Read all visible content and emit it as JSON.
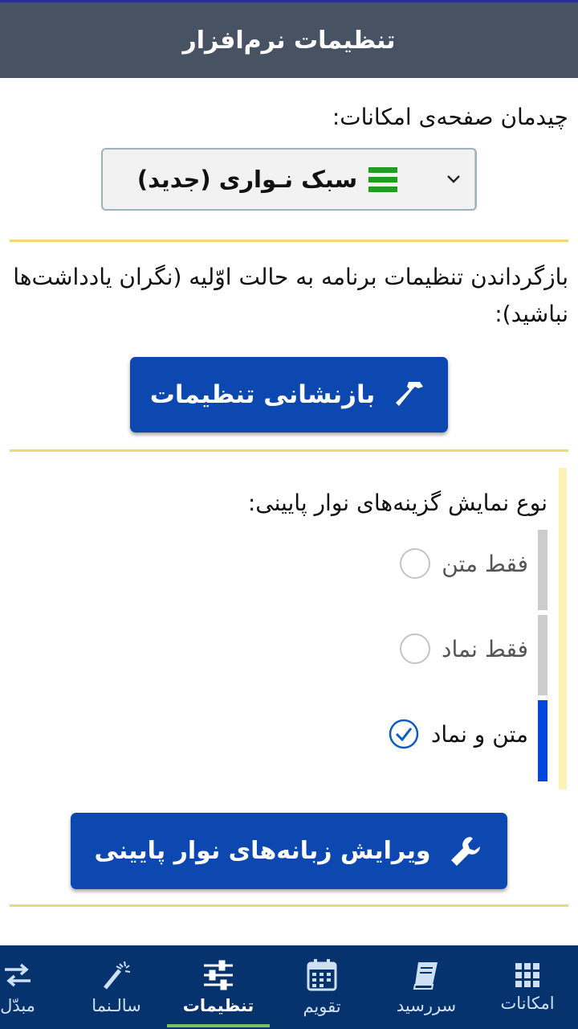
{
  "header": {
    "title": "تنظیمات نرم‌افزار"
  },
  "layout_section": {
    "label": "چیدمان صفحه‌ی امکانات:",
    "select_value": "سبک نـواری (جدید)",
    "select_icon": "green-bars-icon",
    "dropdown_icon": "chevron-down-icon"
  },
  "reset_section": {
    "description": "بازگرداندن تنظیمات برنامه به حالت اوّلیه (نگران یادداشت‌ها نباشید):",
    "button_label": "بازنشانی تنظیمات",
    "button_icon": "hammer-icon"
  },
  "bottom_bar_section": {
    "label": "نوع نمایش گزینه‌های نوار پایینی:",
    "options": [
      {
        "label": "فقط متن",
        "selected": false
      },
      {
        "label": "فقط نماد",
        "selected": false
      },
      {
        "label": "متن و نماد",
        "selected": true
      }
    ],
    "edit_button_label": "ویرایش زبانه‌های نوار پایینی",
    "edit_button_icon": "wrench-icon"
  },
  "bottom_nav": {
    "items": [
      {
        "label": "امکانات",
        "icon": "grid-icon",
        "active": false
      },
      {
        "label": "سررسید",
        "icon": "book-icon",
        "active": false
      },
      {
        "label": "تقویم",
        "icon": "calendar-icon",
        "active": false
      },
      {
        "label": "تنظیمات",
        "icon": "sliders-icon",
        "active": true
      },
      {
        "label": "سالـنما",
        "icon": "magic-wand-icon",
        "active": false
      },
      {
        "label": "مبدّل",
        "icon": "swap-arrows-icon",
        "active": false
      }
    ]
  },
  "colors": {
    "header_bg": "#475263",
    "primary_button": "#0d47b0",
    "divider": "#ecd97a",
    "nav_bg": "#06336e",
    "nav_active_underline": "#79c35c",
    "select_icon_green": "#1e9e1e",
    "radio_selected_bar": "#0047e0"
  }
}
